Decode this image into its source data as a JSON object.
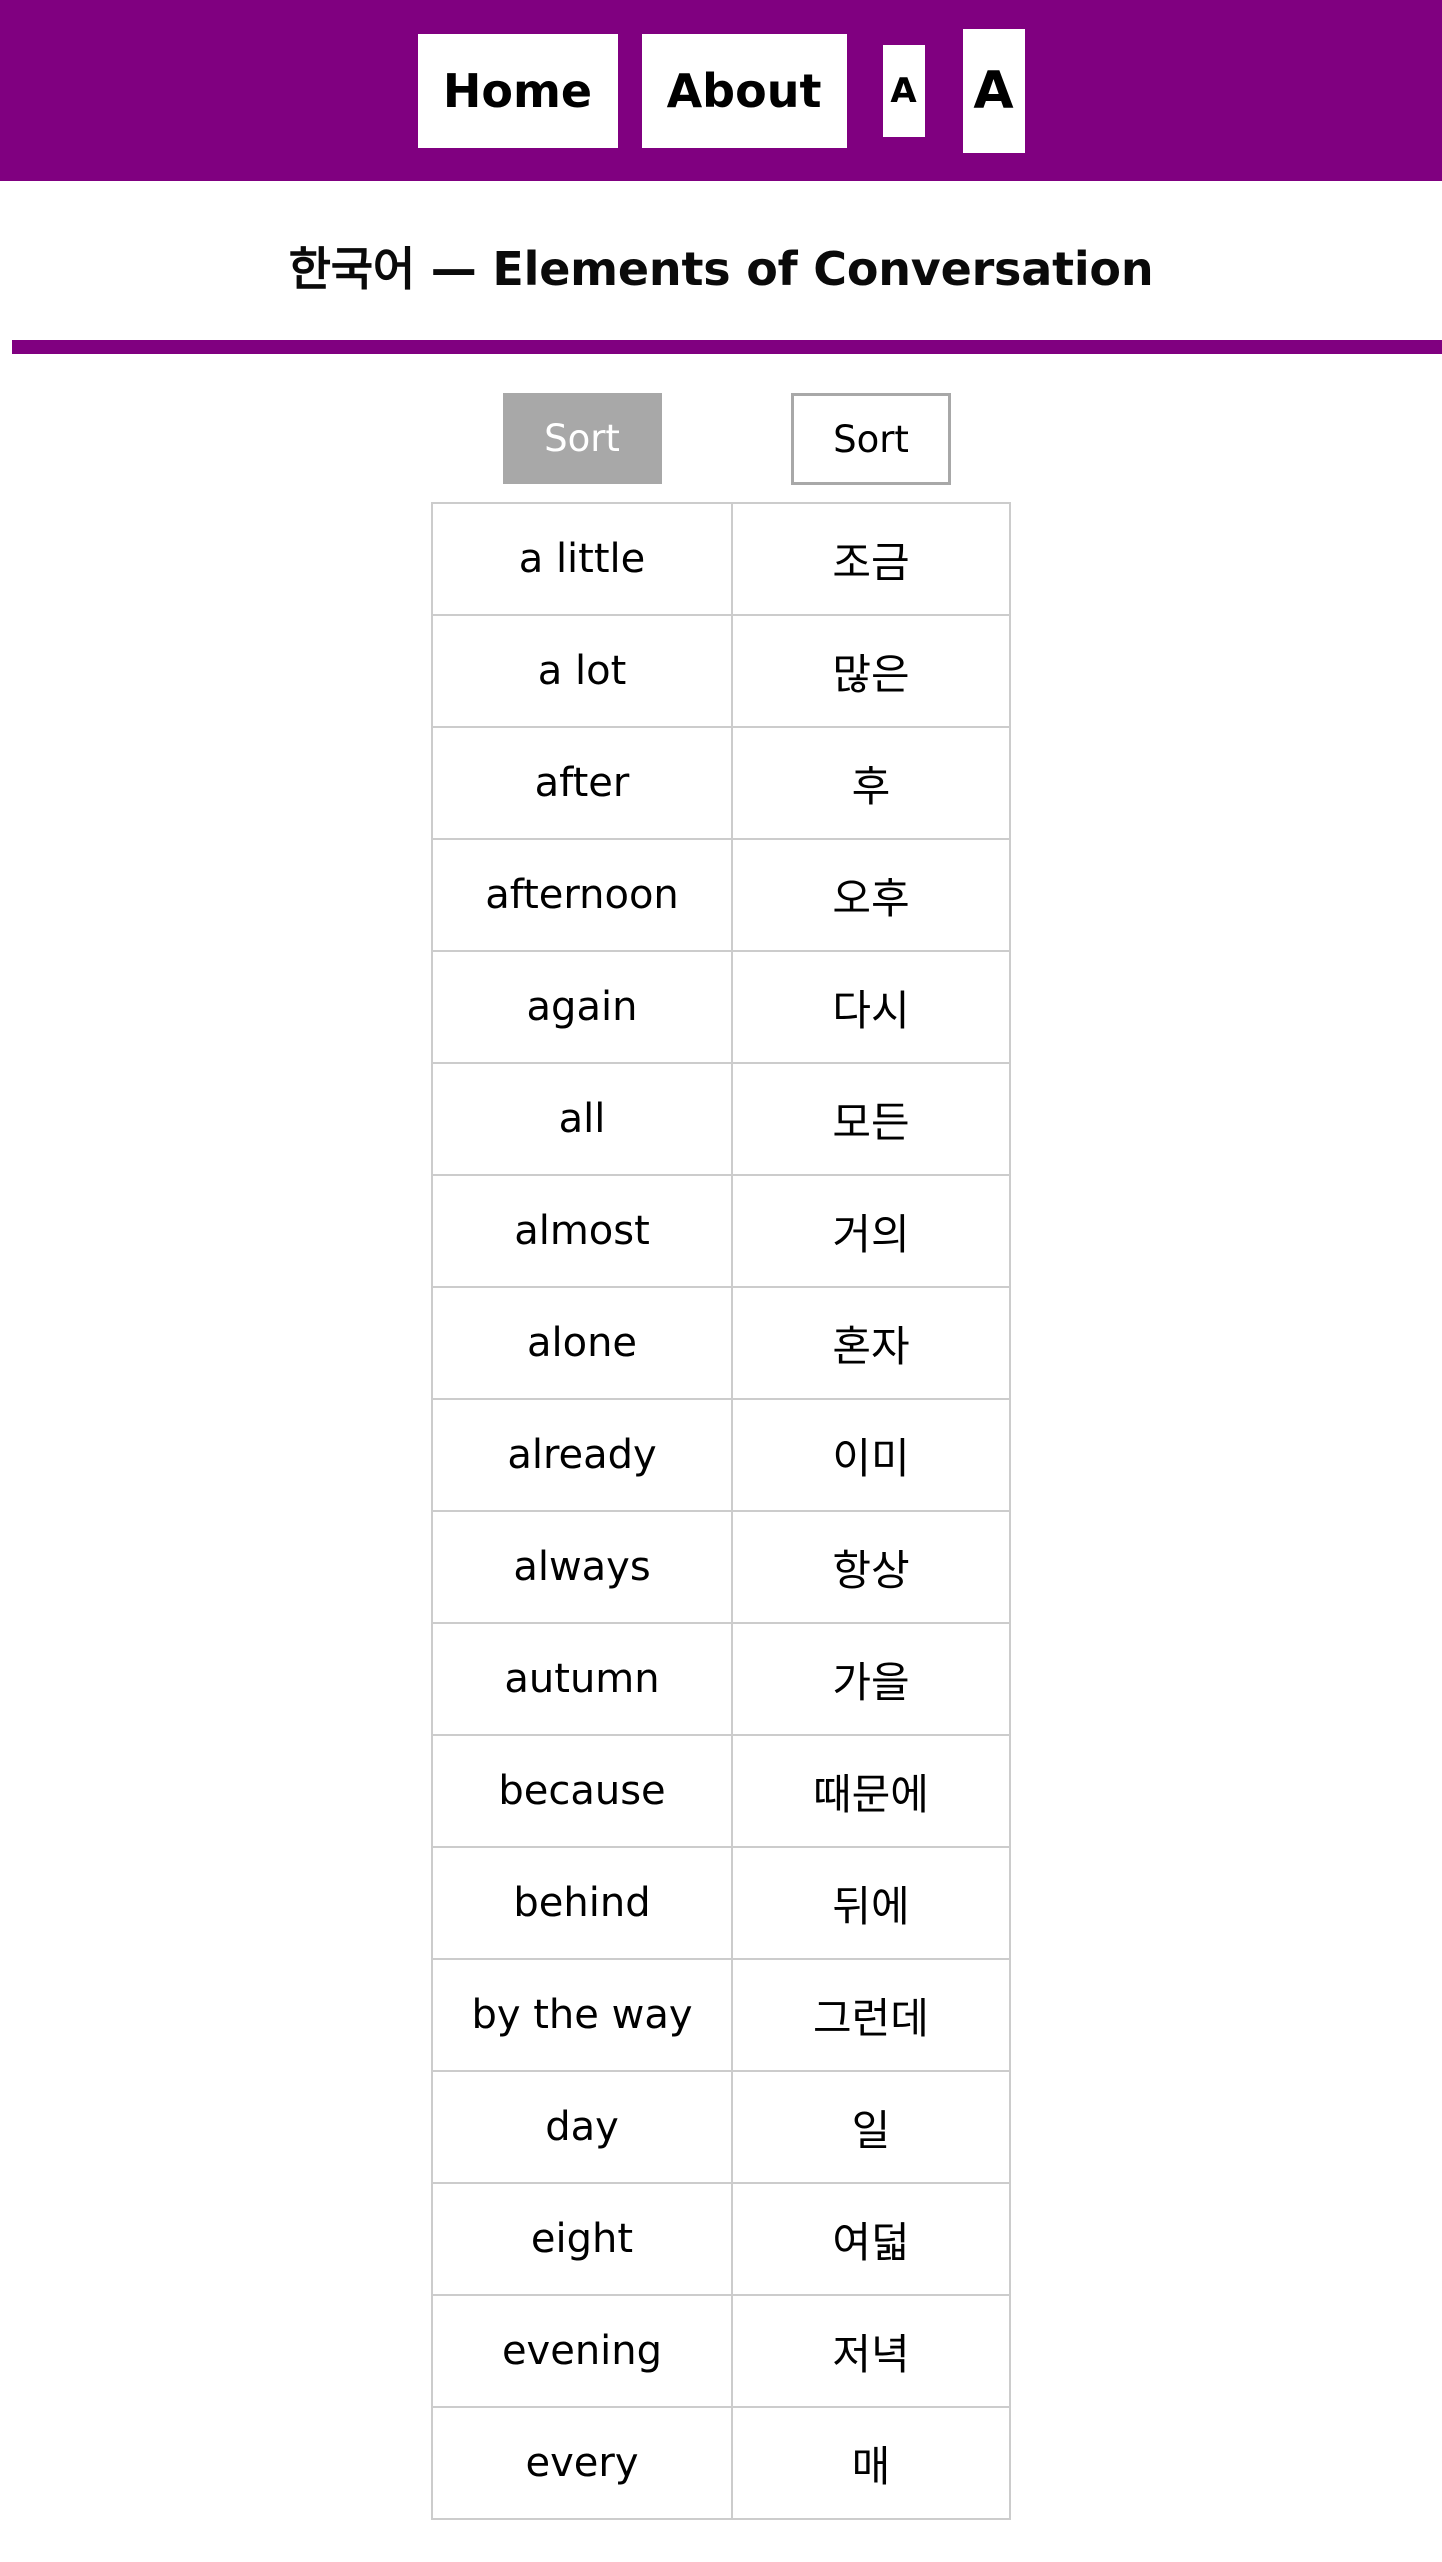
{
  "theme": {
    "brand_purple": "#800080",
    "active_gray": "#a8a8a8",
    "border_gray": "#cccccc"
  },
  "navbar": {
    "items": [
      {
        "label": "Home",
        "name": "nav-home"
      },
      {
        "label": "About",
        "name": "nav-about"
      },
      {
        "label": "A",
        "name": "decrease-font-size"
      },
      {
        "label": "A",
        "name": "increase-font-size"
      }
    ]
  },
  "header": {
    "title": "한국어 — Elements of Conversation"
  },
  "controls": {
    "sort_english_label": "Sort",
    "sort_korean_label": "Sort",
    "sort_english_active": true,
    "sort_korean_active": false
  },
  "table": {
    "rows": [
      {
        "english": "a little",
        "korean": "조금"
      },
      {
        "english": "a lot",
        "korean": "많은"
      },
      {
        "english": "after",
        "korean": "후"
      },
      {
        "english": "afternoon",
        "korean": "오후"
      },
      {
        "english": "again",
        "korean": "다시"
      },
      {
        "english": "all",
        "korean": "모든"
      },
      {
        "english": "almost",
        "korean": "거의"
      },
      {
        "english": "alone",
        "korean": "혼자"
      },
      {
        "english": "already",
        "korean": "이미"
      },
      {
        "english": "always",
        "korean": "항상"
      },
      {
        "english": "autumn",
        "korean": "가을"
      },
      {
        "english": "because",
        "korean": "때문에"
      },
      {
        "english": "behind",
        "korean": "뒤에"
      },
      {
        "english": "by the way",
        "korean": "그런데"
      },
      {
        "english": "day",
        "korean": "일"
      },
      {
        "english": "eight",
        "korean": "여덟"
      },
      {
        "english": "evening",
        "korean": "저녁"
      },
      {
        "english": "every",
        "korean": "매"
      }
    ]
  }
}
